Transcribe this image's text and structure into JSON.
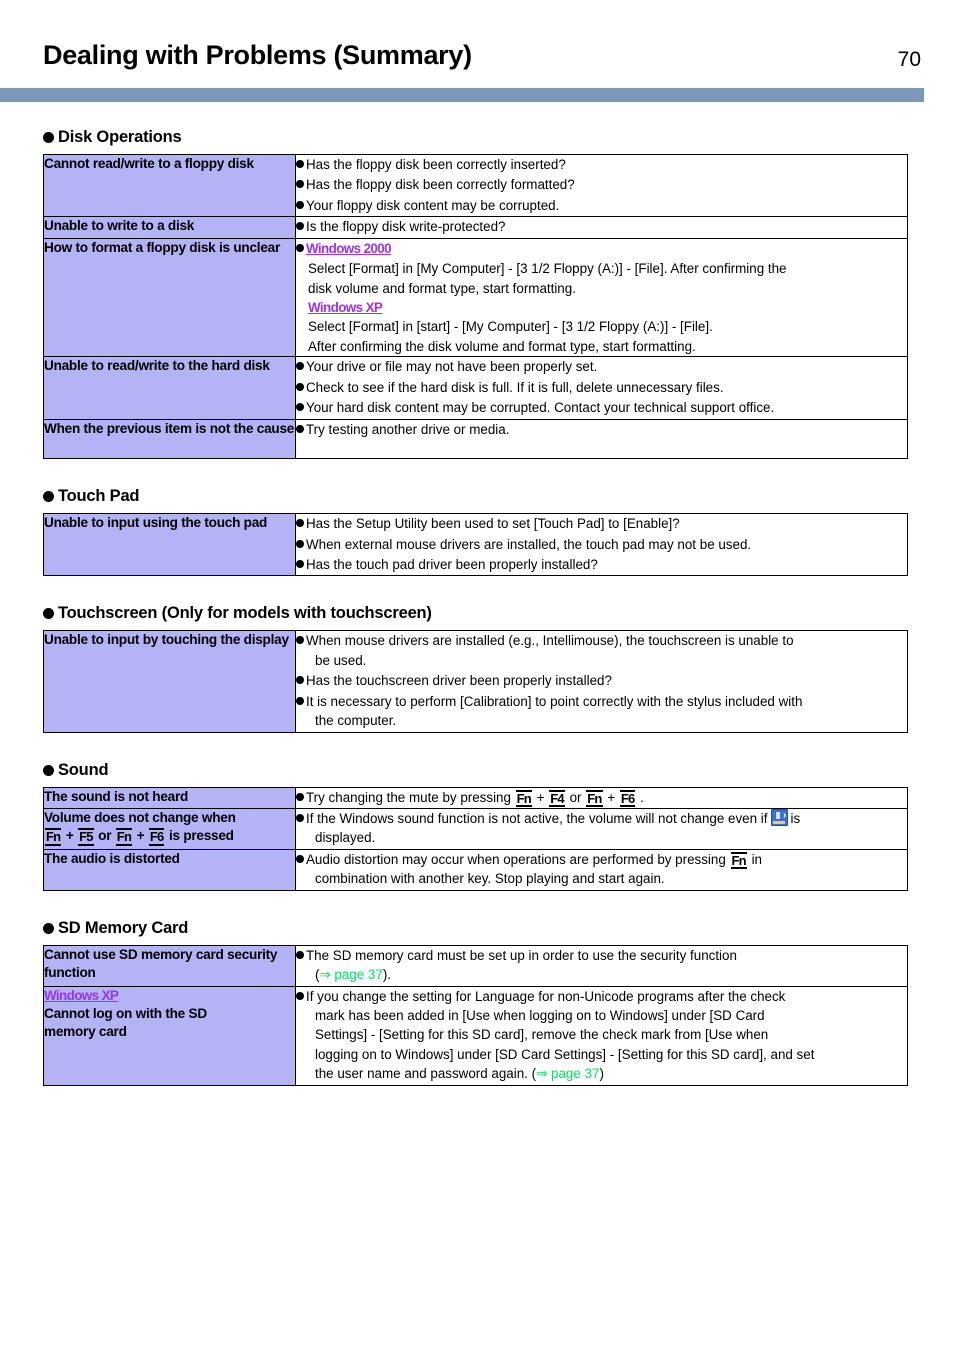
{
  "header": {
    "title": "Dealing with Problems (Summary)",
    "page_number": "70",
    "rule_color": "#7c97b7"
  },
  "colors": {
    "cell_bg": "#b3b3f5",
    "windows_tag": "#9a33ee",
    "page_ref": "#00e060",
    "rule": "#7c97b7"
  },
  "sections": [
    {
      "heading": "Disk Operations",
      "rows": [
        {
          "question": "Cannot read/write to a floppy disk",
          "answers": [
            "Has the floppy disk been correctly inserted?",
            "Has the floppy disk been correctly formatted?",
            "Your floppy disk content may be corrupted."
          ]
        },
        {
          "question": "Unable to write to a disk",
          "answers": [
            "Is the floppy disk write-protected?"
          ]
        },
        {
          "question": "How to format a floppy disk is unclear",
          "answers_rich": {
            "win2000_tag": "Windows 2000",
            "win2000_text_1": "Select [Format] in [My Computer] - [3 1/2 Floppy (A:)] - [File].  After confirming the",
            "win2000_text_2": "disk volume and format type, start formatting.",
            "winxp_tag": "Windows XP",
            "winxp_text_1": "Select [Format] in [start] - [My Computer] - [3 1/2 Floppy (A:)] - [File].",
            "winxp_text_2": "After confirming the disk volume and format type, start formatting."
          }
        },
        {
          "question": "Unable to read/write to the hard disk",
          "answers": [
            "Your drive or file may not have been properly set.",
            "Check to see if the hard disk is full. If it is full, delete unnecessary files.",
            "Your hard disk content may be corrupted. Contact your technical support office."
          ]
        },
        {
          "question": "When the previous item is not the cause",
          "answers": [
            "Try testing another drive or media."
          ]
        }
      ]
    },
    {
      "heading": "Touch Pad",
      "rows": [
        {
          "question": "Unable to input using the touch pad",
          "answers": [
            "Has the Setup Utility been used to set [Touch Pad] to [Enable]?",
            "When external mouse drivers are installed, the touch pad may not be used.",
            "Has the touch pad driver been properly installed?"
          ]
        }
      ]
    },
    {
      "heading": "Touchscreen (Only for models with touchscreen)",
      "rows": [
        {
          "question": "Unable to input by touching the display",
          "answers_wrapped": [
            [
              "When mouse drivers are installed (e.g., Intellimouse), the touchscreen is unable to",
              "be used."
            ],
            [
              "Has the touchscreen driver been properly installed?"
            ],
            [
              "It is necessary to perform [Calibration] to point correctly with the stylus included with",
              "the computer."
            ]
          ]
        }
      ]
    },
    {
      "heading": "Sound",
      "rows": [
        {
          "question": "The sound is not heard",
          "answer_keys": {
            "prefix": "Try changing the mute by pressing ",
            "key1": "Fn",
            "plus1": "+",
            "key2": "F4",
            "or": "or",
            "key3": "Fn",
            "plus2": "+",
            "key4": "F6",
            "suffix": "."
          }
        },
        {
          "question_keys": {
            "line1": "Volume does not change when",
            "key1": "Fn",
            "plus1": "+",
            "key2": "F5",
            "or": "or",
            "key3": "Fn",
            "plus2": "+",
            "key4": "F6",
            "tail": "is pressed"
          },
          "answer_icon": {
            "text1": "If the Windows sound function is not active, the volume will not change even if",
            "icon": "speaker-icon",
            "text2": "is",
            "text3": "displayed."
          }
        },
        {
          "question": "The audio is distorted",
          "answer_keys2": {
            "prefix": "Audio distortion may occur when operations are performed by pressing",
            "key1": "Fn",
            "suffix": "in",
            "line2": "combination with another key. Stop playing and start again."
          }
        }
      ]
    },
    {
      "heading": "SD Memory Card",
      "rows": [
        {
          "question": "Cannot use SD memory card security function",
          "answer_pageref": {
            "line1": "The SD memory card must be set up in order to use the security function",
            "open_paren": "(",
            "ref": "⇒ page 37",
            "close": ")."
          }
        },
        {
          "question_win": {
            "tag": "Windows XP",
            "line1": "Cannot log on with the SD",
            "line2": "memory card"
          },
          "answer_long": {
            "l1": "If you change the setting for Language for non-Unicode programs after the check",
            "l2": "mark has been added in [Use when logging on to Windows] under [SD Card",
            "l3": "Settings] - [Setting for this SD card], remove the check mark from [Use when",
            "l4": "logging on to Windows] under [SD Card Settings] - [Setting for this SD card], and set",
            "l5_a": "the user name and password again. (",
            "l5_ref": "⇒ page 37",
            "l5_b": ")"
          }
        }
      ]
    }
  ]
}
